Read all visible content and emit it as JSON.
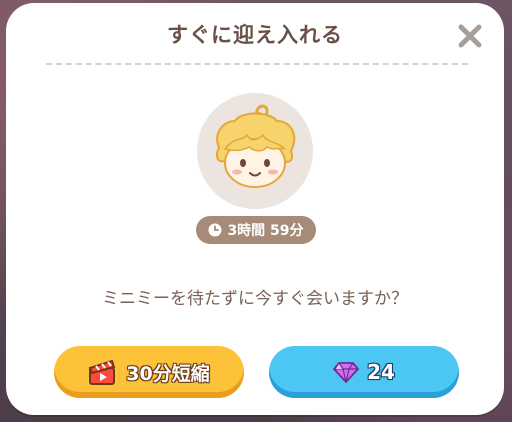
{
  "dialog": {
    "title": "すぐに迎え入れる",
    "timer_text": "3時間 59分",
    "question": "ミニミーを待たずに今すぐ会いますか？",
    "ad_button_label": "30分短縮",
    "gem_button_value": "24"
  },
  "icons": {
    "close": "close-icon",
    "clock": "clock-icon",
    "avatar": "character-face",
    "ad": "clapperboard-icon",
    "gem": "gem-icon"
  },
  "colors": {
    "title": "#6a5148",
    "timer_bg": "#a58b78",
    "ad_button": "#fec23a",
    "gem_button": "#4cc7f3"
  }
}
